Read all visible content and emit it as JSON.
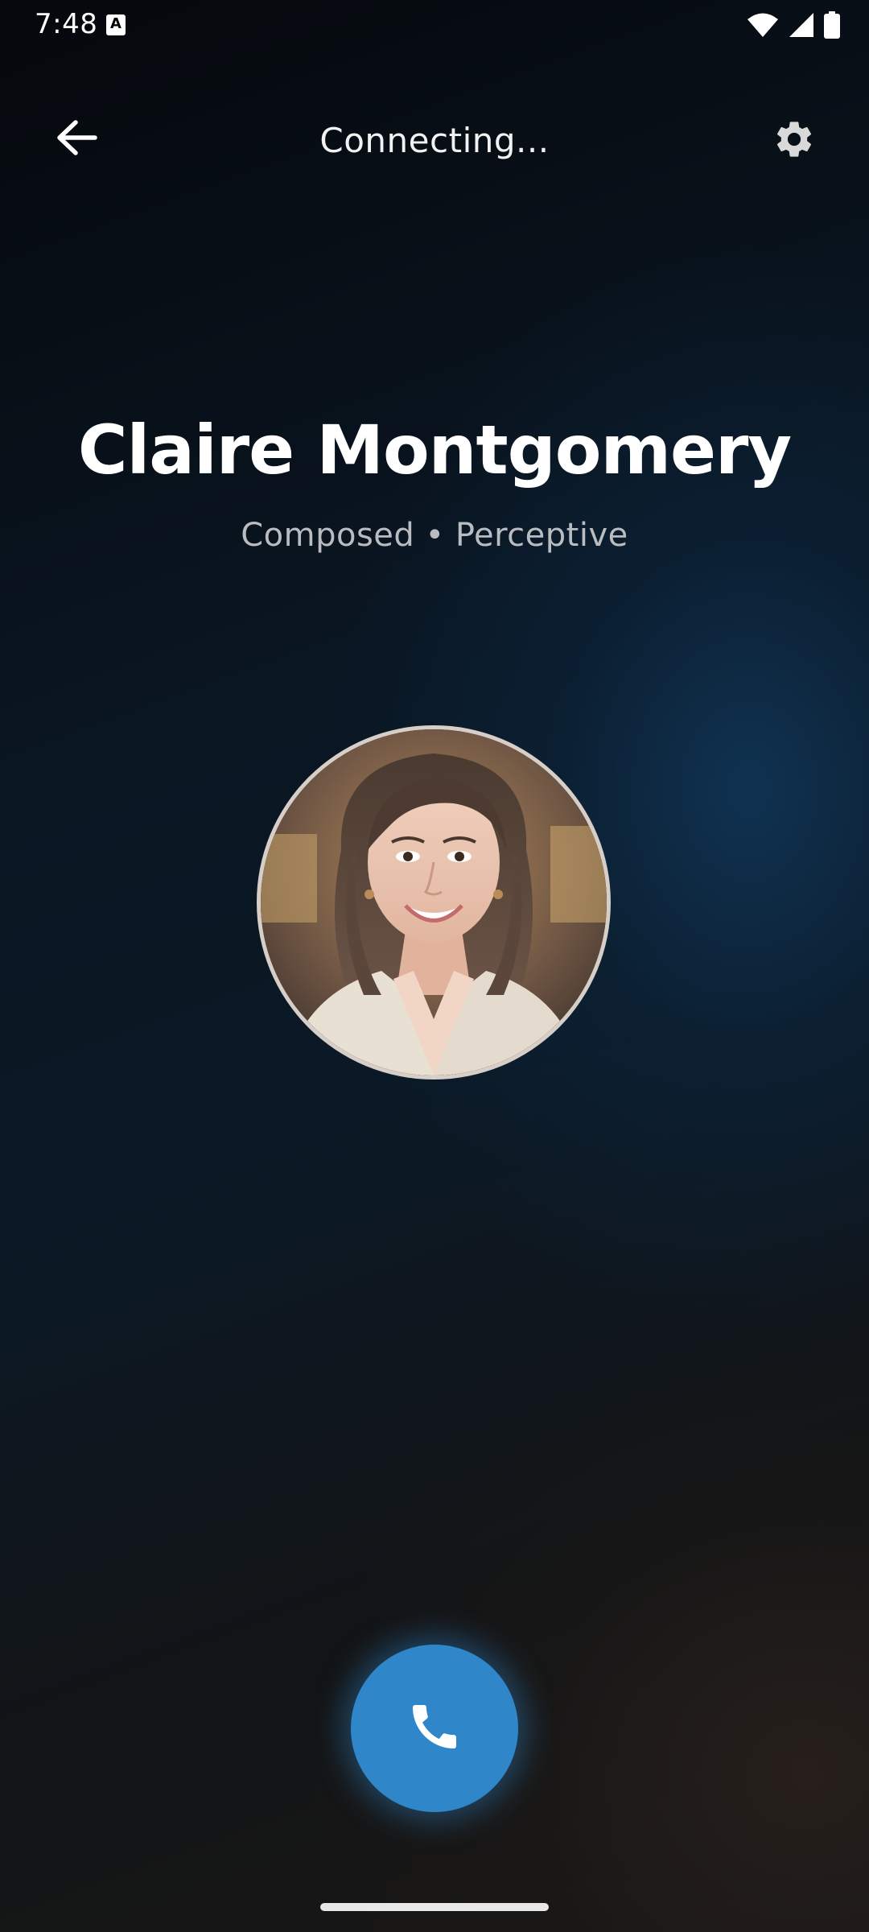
{
  "status_bar": {
    "time": "7:48",
    "notification_icon": "a-icon"
  },
  "header": {
    "title": "Connecting...",
    "back_icon": "arrow-left-icon",
    "settings_icon": "gear-icon"
  },
  "contact": {
    "name": "Claire Montgomery",
    "traits": "Composed • Perceptive",
    "avatar": "avatar"
  },
  "actions": {
    "call_icon": "phone-icon",
    "call_color": "#2f86c8"
  },
  "colors": {
    "background_dark": "#05080c",
    "accent": "#2f86c8",
    "text_primary": "#ffffff",
    "text_secondary": "#b9bcc0"
  }
}
